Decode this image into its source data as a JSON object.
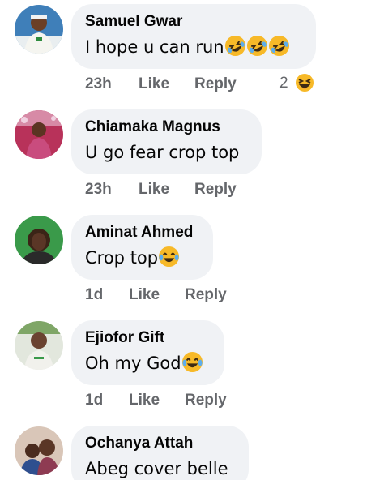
{
  "comments": [
    {
      "author": "Samuel Gwar",
      "text": "I hope u can run",
      "emojis": [
        "rolling-laughing",
        "rolling-laughing",
        "rolling-laughing"
      ],
      "time": "23h",
      "like_label": "Like",
      "reply_label": "Reply",
      "reaction_count": "2",
      "reaction_icon": "haha"
    },
    {
      "author": "Chiamaka Magnus",
      "text": "U go fear crop top",
      "emojis": [],
      "time": "23h",
      "like_label": "Like",
      "reply_label": "Reply"
    },
    {
      "author": "Aminat Ahmed",
      "text": "Crop top",
      "emojis": [
        "tears-of-joy"
      ],
      "time": "1d",
      "like_label": "Like",
      "reply_label": "Reply"
    },
    {
      "author": "Ejiofor Gift",
      "text": "Oh my God",
      "emojis": [
        "tears-of-joy"
      ],
      "time": "1d",
      "like_label": "Like",
      "reply_label": "Reply"
    },
    {
      "author": "Ochanya Attah",
      "text": "Abeg cover belle",
      "emojis": [],
      "time": "",
      "like_label": "",
      "reply_label": ""
    }
  ],
  "colors": {
    "bubble": "#f0f2f5",
    "meta_text": "#65676b",
    "emoji_face": "#f7b928"
  }
}
